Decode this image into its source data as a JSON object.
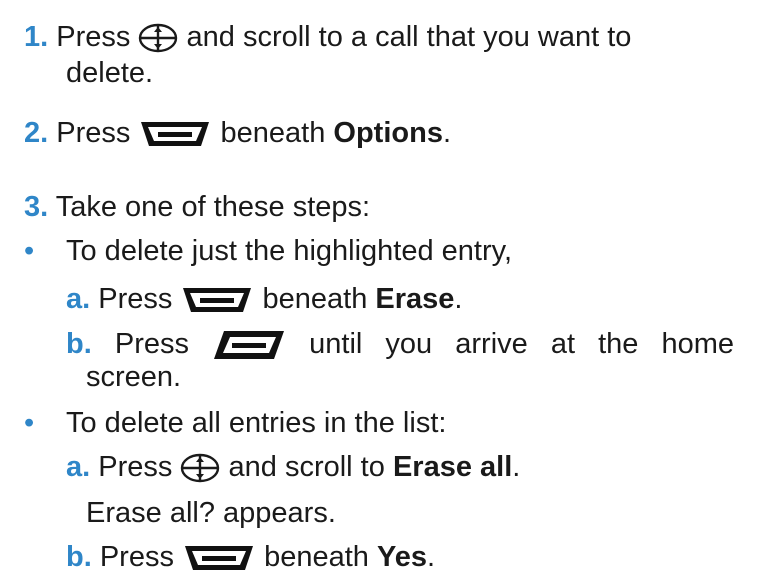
{
  "steps": {
    "s1": {
      "num": "1.",
      "pre": "Press",
      "icon": "nav-key-icon",
      "post": "and scroll to a call that you want to",
      "cont": "delete."
    },
    "s2": {
      "num": "2.",
      "pre": "Press",
      "icon": "right-soft-key-icon",
      "post": "beneath",
      "target": "Options",
      "end": "."
    },
    "s3": {
      "num": "3.",
      "text": "Take one of these steps:"
    }
  },
  "bullets": [
    {
      "symbol": "•",
      "text": "To delete just the highlighted entry,",
      "substeps": [
        {
          "letter": "a.",
          "pre": "Press",
          "icon": "right-soft-key-icon",
          "post": "beneath",
          "target": "Erase",
          "end": "."
        },
        {
          "letter": "b.",
          "pre": "Press",
          "icon": "end-key-icon",
          "post": "until you arrive at the home",
          "cont": "screen."
        }
      ]
    },
    {
      "symbol": "•",
      "text": "To delete all entries in the list:",
      "substeps": [
        {
          "letter": "a.",
          "pre": "Press",
          "icon": "nav-key-icon",
          "post": "and scroll to",
          "target": "Erase all",
          "end": ".",
          "note": "Erase all? appears."
        },
        {
          "letter": "b.",
          "pre": "Press",
          "icon": "right-soft-key-icon",
          "post": "beneath",
          "target": "Yes",
          "end": "."
        }
      ]
    }
  ]
}
